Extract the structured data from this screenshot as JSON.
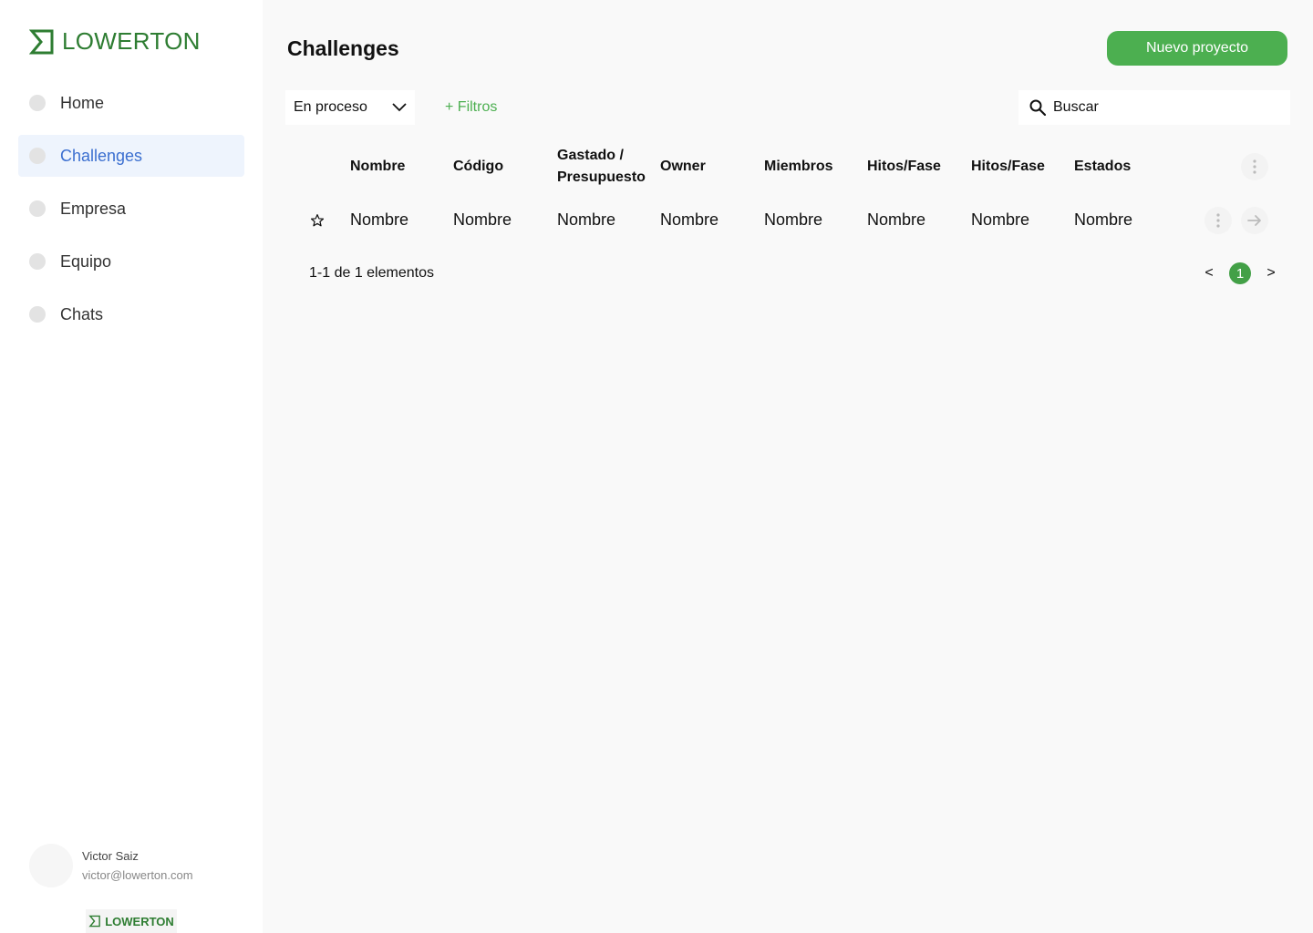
{
  "brand": {
    "name": "LOWERTON",
    "color": "#2e7d32"
  },
  "sidebar": {
    "items": [
      {
        "label": "Home",
        "active": false
      },
      {
        "label": "Challenges",
        "active": true
      },
      {
        "label": "Empresa",
        "active": false
      },
      {
        "label": "Equipo",
        "active": false
      },
      {
        "label": "Chats",
        "active": false
      }
    ],
    "user": {
      "name": "Victor Saiz",
      "email": "victor@lowerton.com"
    }
  },
  "header": {
    "title": "Challenges",
    "new_button_label": "Nuevo proyecto"
  },
  "toolbar": {
    "status_select": "En proceso",
    "filters_label": "+ Filtros",
    "search_placeholder": "Buscar"
  },
  "table": {
    "columns": [
      "Nombre",
      "Código",
      "Gastado / Presupuesto",
      "Owner",
      "Miembros",
      "Hitos/Fase",
      "Hitos/Fase",
      "Estados"
    ],
    "rows": [
      [
        "Nombre",
        "Nombre",
        "Nombre",
        "Nombre",
        "Nombre",
        "Nombre",
        "Nombre",
        "Nombre"
      ]
    ]
  },
  "pagination": {
    "summary": "1-1 de 1 elementos",
    "prev": "<",
    "current": "1",
    "next": ">"
  },
  "colors": {
    "accent": "#4caf50",
    "active_nav_bg": "#eef4fd",
    "active_nav_text": "#3b6fd0"
  },
  "icons": [
    "logo-mark-icon",
    "chevron-down-icon",
    "search-icon",
    "star-icon",
    "kebab-icon",
    "arrow-right-icon"
  ]
}
